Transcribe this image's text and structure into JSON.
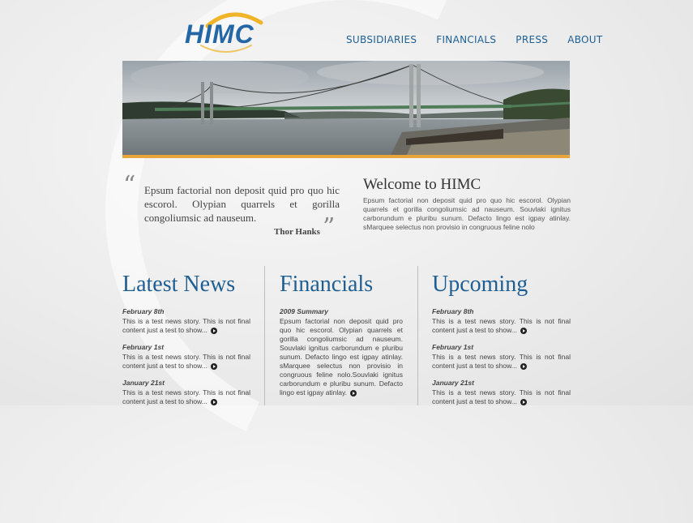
{
  "logo": {
    "text": "HIMC"
  },
  "nav": {
    "items": [
      "SUBSIDIARIES",
      "FINANCIALS",
      "PRESS",
      "ABOUT"
    ]
  },
  "quote": {
    "text": "Epsum factorial non deposit quid pro quo hic escorol. Olypian quarrels et gorilla congoliumsic ad nauseum.",
    "author": "Thor Hanks"
  },
  "welcome": {
    "title": "Welcome to HIMC",
    "body": "Epsum factorial non deposit quid pro quo hic escorol. Olypian quarrels et gorilla congoliumsic ad nauseum. Souvlaki ignitus carborundum e pluribu sunum. Defacto lingo est igpay atinlay. sMarquee selectus non provisio in congruous feline nolo"
  },
  "columns": {
    "news": {
      "title": "Latest News",
      "items": [
        {
          "date": "February 8th",
          "text": "This is a test news story. This is not final content just a test to show..."
        },
        {
          "date": "February 1st",
          "text": "This is a test news story. This is not final content just a test to show..."
        },
        {
          "date": "January 21st",
          "text": "This is a test news story. This is not final content just a test to show..."
        }
      ]
    },
    "financials": {
      "title": "Financials",
      "items": [
        {
          "date": "2009 Summary",
          "text": "Epsum factorial non deposit quid pro quo hic escorol. Olypian quarrels et gorilla congoliumsic ad nauseum. Souvlaki ignitus carborundum e pluribu sunum. Defacto lingo est igpay atinlay. sMarquee selectus non provisio in congruous feline nolo.Souvlaki ignitus carborundum e pluribu sunum. Defacto lingo est igpay atinlay."
        }
      ]
    },
    "upcoming": {
      "title": "Upcoming",
      "items": [
        {
          "date": "February 8th",
          "text": "This is a test news story. This is not final content just a test to show..."
        },
        {
          "date": "February 1st",
          "text": "This is a test news story. This is not final content just a test to show..."
        },
        {
          "date": "January 21st",
          "text": "This is a test news story. This is not final content just a test to show..."
        }
      ]
    }
  },
  "colors": {
    "accent": "#1e5e93",
    "banner_bar": "#e8a53a",
    "logo": "#2467a6"
  }
}
